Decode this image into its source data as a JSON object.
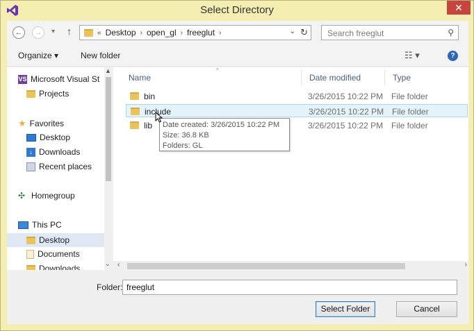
{
  "window": {
    "title": "Select Directory",
    "close_glyph": "✕",
    "app_icon": "visual-studio-icon"
  },
  "nav": {
    "back_glyph": "←",
    "forward_glyph": "→",
    "recent_glyph": "▾",
    "up_glyph": "↑",
    "breadcrumb_prefix": "«",
    "breadcrumbs": [
      "Desktop",
      "open_gl",
      "freeglut"
    ],
    "crumb_sep": "›",
    "dropdown_glyph": "⌄",
    "refresh_glyph": "↻",
    "search_placeholder": "Search freeglut",
    "search_glyph": "⚲"
  },
  "toolbar": {
    "organize_label": "Organize ▾",
    "new_folder_label": "New folder",
    "view_glyph": "☷ ▾",
    "help_glyph": "?"
  },
  "sidebar": {
    "items": [
      {
        "label": "Microsoft Visual St",
        "icon": "visual-studio-icon"
      },
      {
        "label": "Projects",
        "icon": "folder-icon"
      },
      {
        "label": "Favorites",
        "icon": "star-icon"
      },
      {
        "label": "Desktop",
        "icon": "desktop-icon"
      },
      {
        "label": "Downloads",
        "icon": "downloads-icon"
      },
      {
        "label": "Recent places",
        "icon": "recent-places-icon"
      },
      {
        "label": "Homegroup",
        "icon": "homegroup-icon"
      },
      {
        "label": "This PC",
        "icon": "computer-icon"
      },
      {
        "label": "Desktop",
        "icon": "folder-icon"
      },
      {
        "label": "Documents",
        "icon": "documents-icon"
      },
      {
        "label": "Downloads",
        "icon": "folder-icon"
      }
    ],
    "vs_glyph": "VS"
  },
  "files": {
    "headers": {
      "name": "Name",
      "date": "Date modified",
      "type": "Type"
    },
    "sort_glyph": "^",
    "rows": [
      {
        "name": "bin",
        "date": "3/26/2015 10:22 PM",
        "type": "File folder"
      },
      {
        "name": "include",
        "date": "3/26/2015 10:22 PM",
        "type": "File folder"
      },
      {
        "name": "lib",
        "date": "3/26/2015 10:22 PM",
        "type": "File folder"
      }
    ]
  },
  "tooltip": {
    "line1": "Date created: 3/26/2015 10:22 PM",
    "line2": "Size: 36.8 KB",
    "line3": "Folders: GL"
  },
  "scroll": {
    "up_glyph": "▲",
    "down_glyph": "⌄",
    "left_glyph": "‹",
    "right_glyph": "›"
  },
  "footer": {
    "folder_label": "Folder:",
    "folder_value": "freeglut",
    "select_label": "Select Folder",
    "cancel_label": "Cancel"
  },
  "colors": {
    "window_frame": "#f5eeb2",
    "close_button": "#c7453f",
    "selection": "#e5f3fb",
    "folder": "#e9c35b"
  }
}
